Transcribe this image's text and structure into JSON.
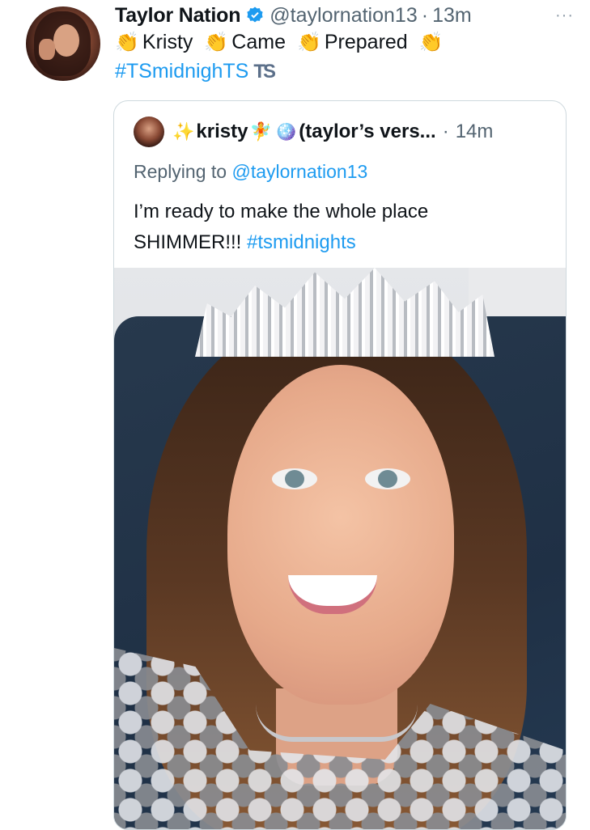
{
  "tweet": {
    "display_name": "Taylor Nation",
    "handle": "@taylornation13",
    "separator": "·",
    "time": "13m",
    "more": "···",
    "line1": {
      "words": [
        "Kristy",
        "Came",
        "Prepared"
      ],
      "clap": "👏"
    },
    "hashtag": "#TSmidnighTS",
    "ts_badge": "TS"
  },
  "quote": {
    "name": "kristy",
    "name_suffix": "(taylor’s vers...",
    "separator": "·",
    "time": "14m",
    "sparkles": "✨",
    "fairy": "🧚",
    "disco": "🪩",
    "replying_prefix": "Replying to",
    "replying_handle": "@taylornation13",
    "text_line1": "I’m ready to make the whole place",
    "text_line2_plain": "SHIMMER!!! ",
    "text_line2_tag": "#tsmidnights"
  },
  "colors": {
    "link": "#1d9bf0",
    "muted": "#536471",
    "verified": "#1d9bf0"
  }
}
